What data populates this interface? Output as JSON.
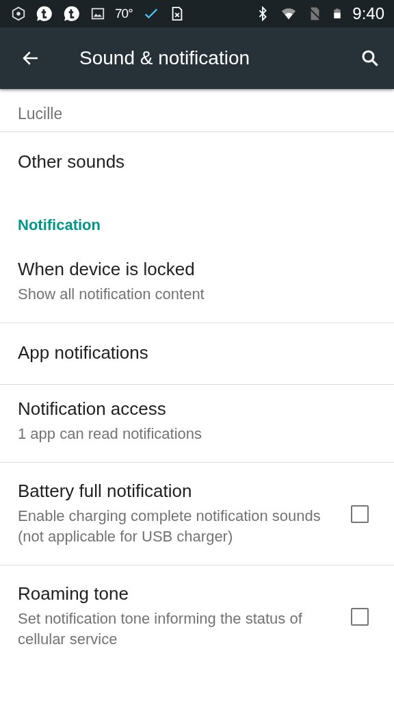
{
  "status_bar": {
    "temperature": "70°",
    "time": "9:40"
  },
  "app_bar": {
    "title": "Sound & notification"
  },
  "groups": [
    {
      "items": [
        {
          "kind": "partial",
          "title": "Lucille"
        }
      ]
    },
    {
      "items": [
        {
          "kind": "item",
          "title": "Other sounds"
        },
        {
          "kind": "header",
          "title": "Notification"
        },
        {
          "kind": "item",
          "title": "When device is locked",
          "summary": "Show all notification content"
        }
      ]
    },
    {
      "items": [
        {
          "kind": "item",
          "title": "App notifications"
        }
      ]
    },
    {
      "items": [
        {
          "kind": "item",
          "title": "Notification access",
          "summary": "1 app can read notifications"
        }
      ]
    },
    {
      "items": [
        {
          "kind": "checkbox",
          "title": "Battery full notification",
          "summary": "Enable charging complete notification sounds (not applicable for USB charger)",
          "checked": false
        }
      ]
    },
    {
      "items": [
        {
          "kind": "checkbox",
          "title": "Roaming tone",
          "summary": "Set notification tone informing the status of cellular service",
          "checked": false
        }
      ]
    }
  ]
}
